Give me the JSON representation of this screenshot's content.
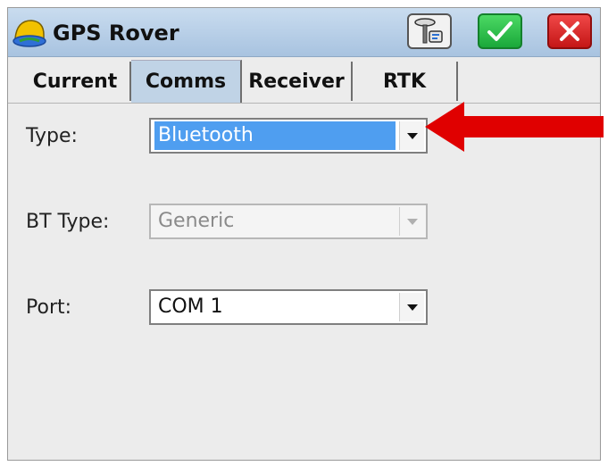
{
  "window": {
    "title": "GPS Rover"
  },
  "toolbar": {
    "receiver_icon": "receiver-icon",
    "ok_icon": "checkmark-icon",
    "cancel_icon": "close-icon"
  },
  "tabs": [
    {
      "label": "Current"
    },
    {
      "label": "Comms",
      "selected": true
    },
    {
      "label": "Receiver"
    },
    {
      "label": "RTK"
    }
  ],
  "form": {
    "type_label": "Type:",
    "type_value": "Bluetooth",
    "bt_type_label": "BT Type:",
    "bt_type_value": "Generic",
    "port_label": "Port:",
    "port_value": "COM 1"
  },
  "colors": {
    "selection": "#4f9ef0",
    "ok_green": "#1aa83a",
    "cancel_red": "#c41616",
    "pointer_arrow": "#e00000"
  }
}
